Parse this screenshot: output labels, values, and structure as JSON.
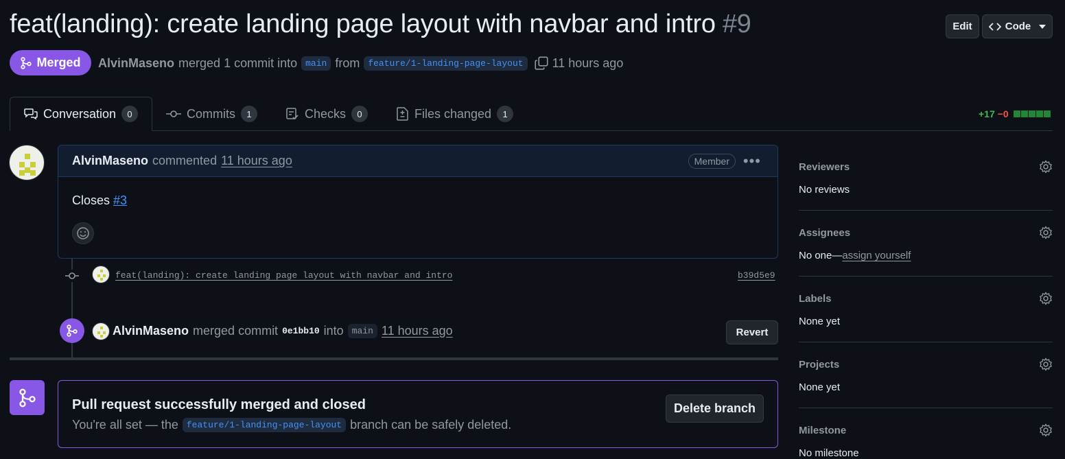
{
  "pr": {
    "title": "feat(landing): create landing page layout with navbar and intro",
    "number": "#9",
    "state": "Merged",
    "author": "AlvinMaseno",
    "merged_text": "merged 1 commit into",
    "base_branch": "main",
    "from_text": "from",
    "head_branch": "feature/1-landing-page-layout",
    "time": "11 hours ago"
  },
  "header_buttons": {
    "edit": "Edit",
    "code": "Code"
  },
  "tabs": [
    {
      "label": "Conversation",
      "count": "0"
    },
    {
      "label": "Commits",
      "count": "1"
    },
    {
      "label": "Checks",
      "count": "0"
    },
    {
      "label": "Files changed",
      "count": "1"
    }
  ],
  "diffstat": {
    "additions": "+17",
    "deletions": "−0"
  },
  "comment": {
    "author": "AlvinMaseno",
    "action": "commented",
    "time": "11 hours ago",
    "badge": "Member",
    "body_prefix": "Closes",
    "body_link": "#3"
  },
  "commit": {
    "message": "feat(landing): create landing page layout with navbar and intro",
    "sha": "b39d5e9"
  },
  "merge_event": {
    "author": "AlvinMaseno",
    "text1": "merged commit",
    "sha": "0e1bb10",
    "text2": "into",
    "base": "main",
    "time": "11 hours ago",
    "revert_label": "Revert"
  },
  "merge_box": {
    "title": "Pull request successfully merged and closed",
    "text_prefix": "You're all set — the",
    "branch": "feature/1-landing-page-layout",
    "text_suffix": "branch can be safely deleted.",
    "delete_label": "Delete branch"
  },
  "sidebar": {
    "reviewers": {
      "title": "Reviewers",
      "value": "No reviews"
    },
    "assignees": {
      "title": "Assignees",
      "value": "No one—",
      "link": "assign yourself"
    },
    "labels": {
      "title": "Labels",
      "value": "None yet"
    },
    "projects": {
      "title": "Projects",
      "value": "None yet"
    },
    "milestone": {
      "title": "Milestone",
      "value": "No milestone"
    }
  },
  "colors": {
    "background": "#0d1117",
    "merged_purple": "#8957e5",
    "link_blue": "#4493f8",
    "addition_green": "#3fb950",
    "deletion_red": "#f85149"
  }
}
